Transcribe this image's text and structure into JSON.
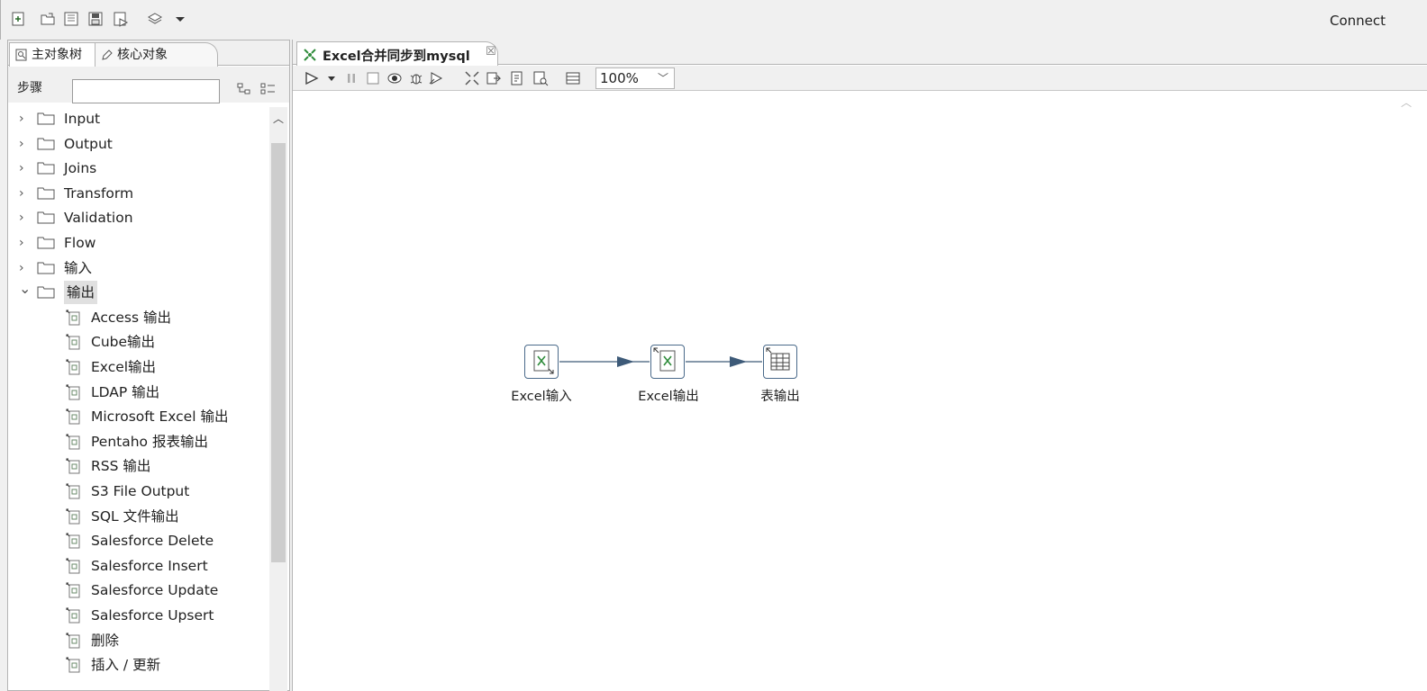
{
  "toolbar": {
    "connect_label": "Connect"
  },
  "left_panel": {
    "tabs": [
      {
        "label": "主对象树",
        "active": true
      },
      {
        "label": "核心对象",
        "active": false
      }
    ],
    "search": {
      "label": "步骤",
      "value": ""
    },
    "tree": {
      "folders": [
        {
          "label": "Input",
          "expanded": false
        },
        {
          "label": "Output",
          "expanded": false
        },
        {
          "label": "Joins",
          "expanded": false
        },
        {
          "label": "Transform",
          "expanded": false
        },
        {
          "label": "Validation",
          "expanded": false
        },
        {
          "label": "Flow",
          "expanded": false
        },
        {
          "label": "输入",
          "expanded": false
        },
        {
          "label": "输出",
          "expanded": true
        }
      ],
      "output_children": [
        "Access 输出",
        "Cube输出",
        "Excel输出",
        "LDAP 输出",
        "Microsoft Excel 输出",
        "Pentaho 报表输出",
        "RSS 输出",
        "S3 File Output",
        "SQL 文件输出",
        "Salesforce Delete",
        "Salesforce Insert",
        "Salesforce Update",
        "Salesforce Upsert",
        "删除",
        "插入 / 更新"
      ]
    }
  },
  "editor": {
    "tab_title": "Excel合并同步到mysql",
    "zoom": "100%",
    "steps": [
      {
        "label": "Excel输入",
        "icon": "excel-input-icon"
      },
      {
        "label": "Excel输出",
        "icon": "excel-output-icon"
      },
      {
        "label": "表输出",
        "icon": "table-output-icon"
      }
    ]
  },
  "colors": {
    "hop": "#3d5a78",
    "node_border": "#4a6a8a",
    "excel_green": "#2e8b3a"
  }
}
